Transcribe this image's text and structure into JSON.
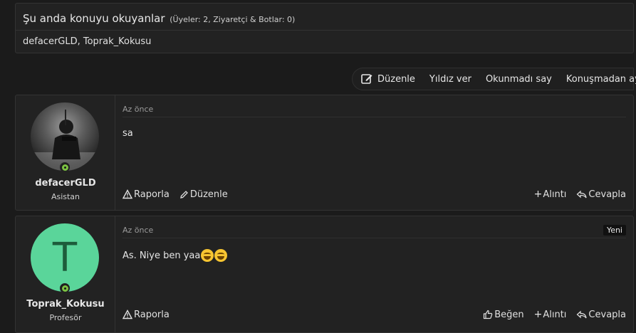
{
  "readers": {
    "title": "Şu anda konuyu okuyanlar",
    "subtitle": "(Üyeler: 2, Ziyaretçi & Botlar: 0)",
    "users": "defacerGLD, Toprak_Kokusu"
  },
  "toolbar": {
    "edit": "Düzenle",
    "rate": "Yıldız ver",
    "unread": "Okunmadı say",
    "leave": "Konuşmadan ayrıl"
  },
  "posts": [
    {
      "username": "defacerGLD",
      "role": "Asistan",
      "time": "Az önce",
      "content": "sa",
      "actions": {
        "report": "Raporla",
        "edit": "Düzenle",
        "quote": "Alıntı",
        "reply": "Cevapla"
      }
    },
    {
      "username": "Toprak_Kokusu",
      "role": "Profesör",
      "avatar_letter": "T",
      "avatar_color": "#5ad59a",
      "time": "Az önce",
      "badge": "Yeni",
      "content": "As. Niye ben yaa",
      "emojis": [
        "grinning-sweat-emoji",
        "laughing-tears-emoji"
      ],
      "actions": {
        "report": "Raporla",
        "like": "Beğen",
        "quote": "Alıntı",
        "reply": "Cevapla"
      }
    }
  ],
  "colors": {
    "online": "#7cc242",
    "background": "#1b1b1b",
    "panel": "#222222"
  }
}
